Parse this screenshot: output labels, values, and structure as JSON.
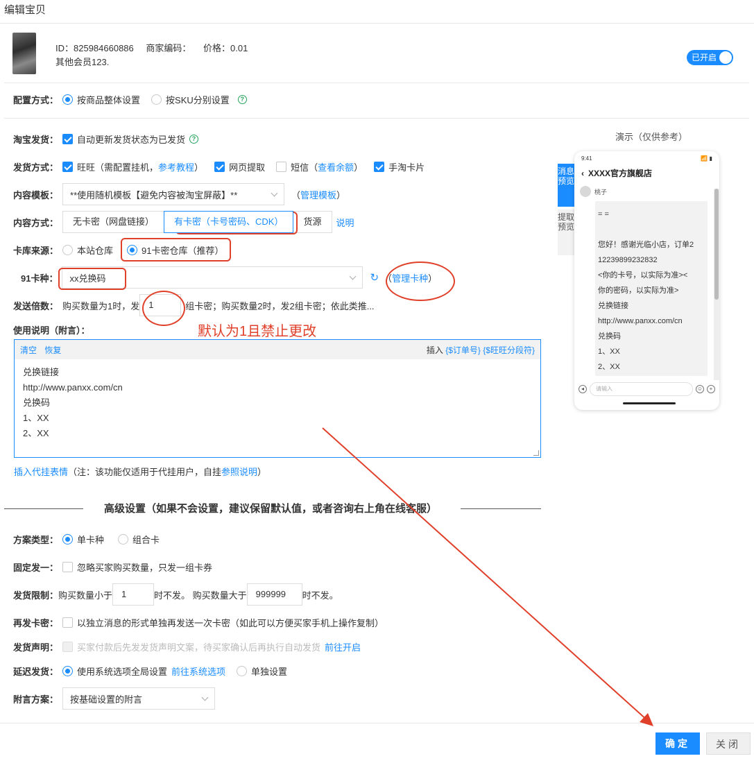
{
  "window": {
    "title": "编辑宝贝"
  },
  "product": {
    "id_label": "ID：825984660886",
    "code_label": "商家编码：",
    "price_label": "价格：0.01",
    "name": "其他会员123.",
    "toggle_label": "已开启"
  },
  "config": {
    "label": "配置方式：",
    "options": [
      "按商品整体设置",
      "按SKU分别设置"
    ],
    "selected": 0,
    "help": "?"
  },
  "taobao_ship": {
    "label": "淘宝发货：",
    "option": "自动更新发货状态为已发货"
  },
  "ship_method": {
    "label": "发货方式：",
    "wangwang": "旺旺（需配置挂机，",
    "wangwang_link": "参考教程",
    "wangwang_close": "）",
    "web": "网页提取",
    "sms": "短信（",
    "sms_link": "查看余额",
    "sms_close": "）",
    "card": "手淘卡片"
  },
  "template": {
    "label": "内容模板：",
    "value": "**使用随机模板【避免内容被淘宝屏蔽】**",
    "manage_open": "（",
    "manage_link": "管理模板",
    "manage_close": "）"
  },
  "content_mode": {
    "label": "内容方式：",
    "options": [
      "无卡密（网盘链接）",
      "有卡密（卡号密码、CDK）",
      "货源"
    ],
    "selected": 1,
    "explain": "说明"
  },
  "source": {
    "label": "卡库来源：",
    "options": [
      "本站仓库",
      "91卡密仓库（推荐）"
    ],
    "selected": 1
  },
  "card_type": {
    "label": "91卡种：",
    "value": "xx兑换码",
    "manage_open": "（",
    "manage_link": "管理卡种",
    "manage_close": "）"
  },
  "send_times": {
    "label": "发送倍数：",
    "prefix": "购买数量为1时，发",
    "value": "1",
    "suffix": "组卡密；购买数量2时，发2组卡密；依此类推..."
  },
  "annotation": "默认为1且禁止更改",
  "usage": {
    "label": "使用说明（附言）：",
    "clear": "清空",
    "restore": "恢复",
    "insert": "插入",
    "insert_order": "{$订单号}",
    "insert_sep": "{$旺旺分段符}",
    "lines": [
      "兑换链接",
      "http://www.panxx.com/cn",
      "兑换码",
      "1、XX",
      "2、XX"
    ]
  },
  "insert_emoji": {
    "link": "插入代挂表情",
    "note": "（注：该功能仅适用于代挂用户，自挂",
    "ref": "参照说明",
    "close": "）"
  },
  "advanced": {
    "title": "高级设置（如果不会设置，建议保留默认值，或者咨询右上角在线客服）"
  },
  "plan_type": {
    "label": "方案类型：",
    "options": [
      "单卡种",
      "组合卡"
    ],
    "selected": 0
  },
  "fixed_one": {
    "label": "固定发一：",
    "option": "忽略买家购买数量，只发一组卡券"
  },
  "limit": {
    "label": "发货限制：",
    "prefix": "购买数量小于",
    "min": "1",
    "mid": "时不发。 购买数量大于",
    "max": "999999",
    "suffix": "时不发。"
  },
  "resend": {
    "label": "再发卡密：",
    "option": "以独立消息的形式单独再发送一次卡密（如此可以方便买家手机上操作复制）"
  },
  "statement": {
    "label": "发货声明：",
    "option": "买家付款后先发发货声明文案，待买家确认后再执行自动发货",
    "link": "前往开启"
  },
  "delay": {
    "label": "延迟发货：",
    "option1": "使用系统选项全局设置",
    "option1_link": "前往系统选项",
    "option2": "单独设置",
    "selected": 0
  },
  "attach_plan": {
    "label": "附言方案：",
    "value": "按基础设置的附言"
  },
  "buttons": {
    "confirm": "确定",
    "close": "关闭"
  },
  "demo": {
    "title": "演示（仅供参考）",
    "tab_active": "消息预览",
    "tab_inactive": "提取预览",
    "time": "9:41",
    "signal": "📶 ▮",
    "shop": "XXXX官方旗舰店",
    "user": "桃子",
    "message_lines": [
      "= =",
      "",
      "您好！感谢光临小店，订单2",
      "12239899232832",
      "<你的卡号，以实际为准><",
      "你的密码，以实际为准>",
      "兑换链接",
      "http://www.panxx.com/cn",
      "兑换码",
      "1、XX",
      "2、XX"
    ],
    "input_placeholder": "请输入"
  },
  "colors": {
    "accent": "#1a8cff",
    "annotation": "#e0402a"
  }
}
